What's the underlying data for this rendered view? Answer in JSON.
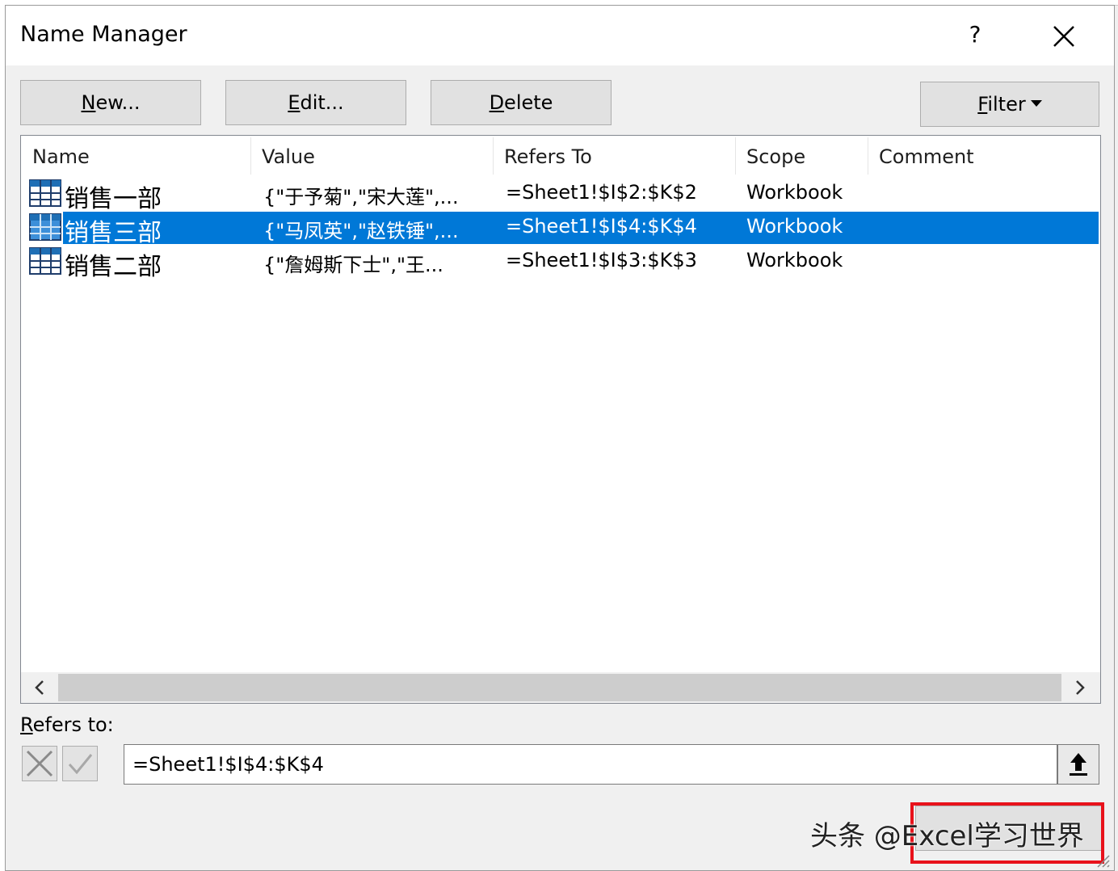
{
  "dialog": {
    "title": "Name Manager",
    "help_glyph": "?",
    "buttons": {
      "new": {
        "mnemonic": "N",
        "rest": "ew..."
      },
      "edit": {
        "mnemonic": "E",
        "rest": "dit..."
      },
      "delete": {
        "mnemonic": "D",
        "rest": "elete"
      },
      "filter": {
        "mnemonic": "F",
        "rest": "ilter"
      }
    },
    "columns": [
      "Name",
      "Value",
      "Refers To",
      "Scope",
      "Comment"
    ],
    "rows": [
      {
        "name": "销售一部",
        "value": "{\"于予菊\",\"宋大莲\",...",
        "refers_to": "=Sheet1!$I$2:$K$2",
        "scope": "Workbook",
        "comment": "",
        "selected": false
      },
      {
        "name": "销售三部",
        "value": "{\"马凤英\",\"赵铁锤\",...",
        "refers_to": "=Sheet1!$I$4:$K$4",
        "scope": "Workbook",
        "comment": "",
        "selected": true
      },
      {
        "name": "销售二部",
        "value": "{\"詹姆斯下士\",\"王...",
        "refers_to": "=Sheet1!$I$3:$K$3",
        "scope": "Workbook",
        "comment": "",
        "selected": false
      }
    ],
    "refers_label": {
      "mnemonic": "R",
      "rest": "efers to:"
    },
    "refers_value": "=Sheet1!$I$4:$K$4"
  },
  "watermark": "头条 @Excel学习世界",
  "colors": {
    "selection": "#0078d7",
    "highlight_box": "#e8121b"
  }
}
